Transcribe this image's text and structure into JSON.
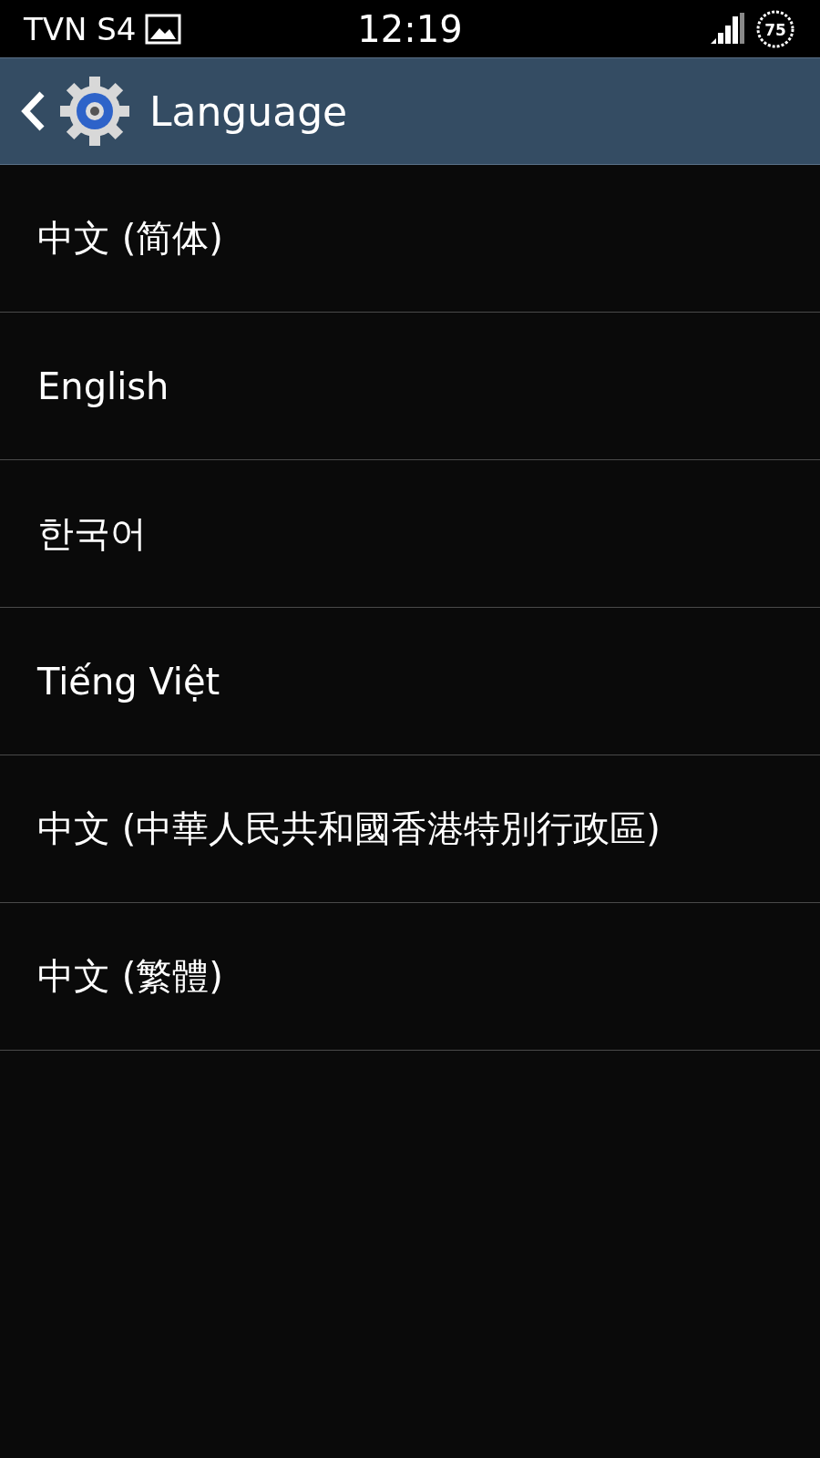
{
  "status_bar": {
    "carrier": "TVN S4",
    "time": "12:19",
    "battery": "75"
  },
  "header": {
    "title": "Language"
  },
  "languages": [
    {
      "label": "中文 (简体)"
    },
    {
      "label": "English"
    },
    {
      "label": "한국어"
    },
    {
      "label": "Tiếng Việt"
    },
    {
      "label": "中文 (中華人民共和國香港特別行政區)"
    },
    {
      "label": "中文 (繁體)"
    }
  ]
}
